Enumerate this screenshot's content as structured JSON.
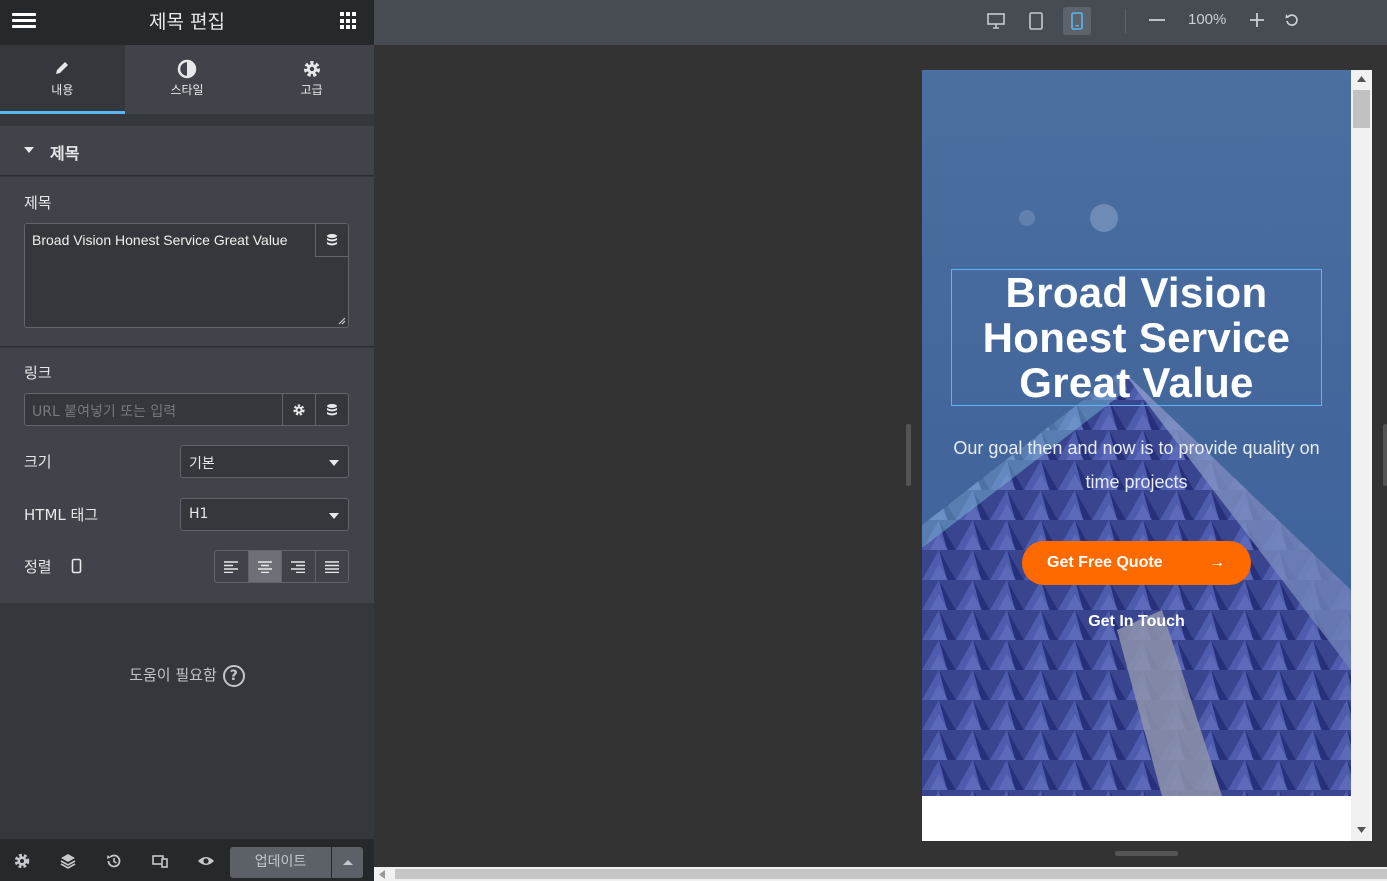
{
  "panel": {
    "title": "제목 편집",
    "tabs": [
      {
        "label": "내용",
        "icon": "pencil-icon",
        "active": true
      },
      {
        "label": "스타일",
        "icon": "contrast-icon",
        "active": false
      },
      {
        "label": "고급",
        "icon": "gear-icon",
        "active": false
      }
    ],
    "section_title": "제목",
    "title_field": {
      "label": "제목",
      "value": "Broad Vision Honest Service Great Value"
    },
    "link_field": {
      "label": "링크",
      "placeholder": "URL 붙여넣기 또는 입력"
    },
    "size_field": {
      "label": "크기",
      "value": "기본"
    },
    "html_tag_field": {
      "label": "HTML 태그",
      "value": "H1"
    },
    "alignment_field": {
      "label": "정렬",
      "options": [
        "left",
        "center",
        "right",
        "justify"
      ],
      "selected": "center"
    },
    "help_text": "도움이 필요함",
    "help_icon": "?",
    "footer": {
      "update_label": "업데이트"
    }
  },
  "topbar": {
    "devices": [
      "desktop",
      "tablet",
      "mobile"
    ],
    "active_device": "mobile",
    "zoom": "100%"
  },
  "preview": {
    "headline": "Broad Vision Honest Service Great Value",
    "subtext": "Our goal then and now is to provide quality on time projects",
    "primary_button": "Get Free Quote",
    "primary_button_arrow": "→",
    "secondary_link": "Get In Touch"
  },
  "colors": {
    "accent": "#5ab6f0",
    "cta": "#ff6a00",
    "panel_bg": "#404349"
  }
}
